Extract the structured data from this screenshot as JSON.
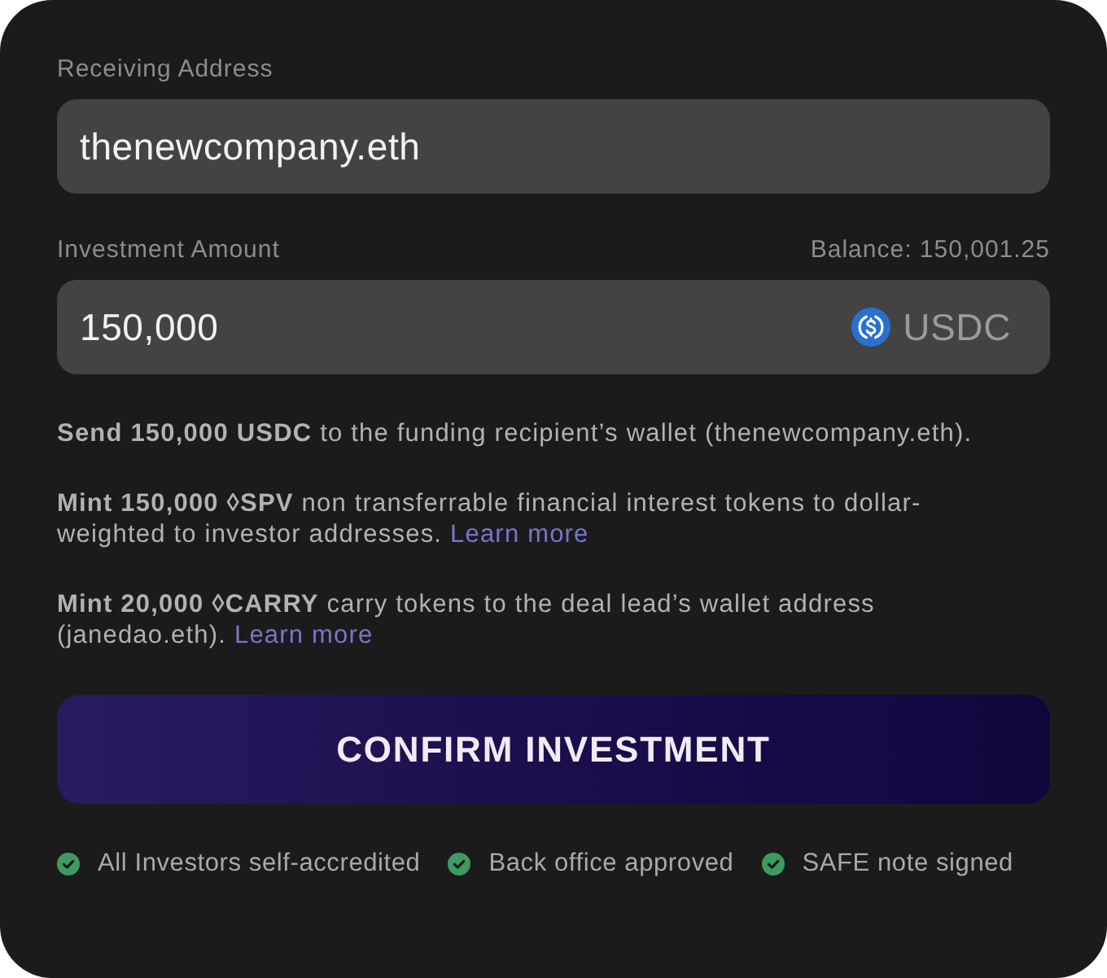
{
  "address": {
    "label": "Receiving Address",
    "value": "thenewcompany.eth"
  },
  "amount": {
    "label": "Investment Amount",
    "balance": "Balance: 150,001.25",
    "value": "150,000",
    "currency": "USDC"
  },
  "summary": [
    {
      "text": "**Send 150,000 USDC** to the funding recipient’s wallet (thenewcompany.eth)."
    },
    {
      "text": "**Mint 150,000 ◊SPV** non transferrable financial interest tokens to dollar-weighted to investor addresses.",
      "link": "Learn more"
    },
    {
      "text": "**Mint 20,000 ◊CARRY** carry tokens to the deal lead’s wallet address (janedao.eth).",
      "link": "Learn more"
    }
  ],
  "confirm_button": {
    "label": "CONFIRM INVESTMENT"
  },
  "checklist": [
    {
      "label": "All Investors self-accredited",
      "checked": true
    },
    {
      "label": "Back office approved",
      "checked": true
    },
    {
      "label": "SAFE note signed",
      "checked": true
    }
  ]
}
